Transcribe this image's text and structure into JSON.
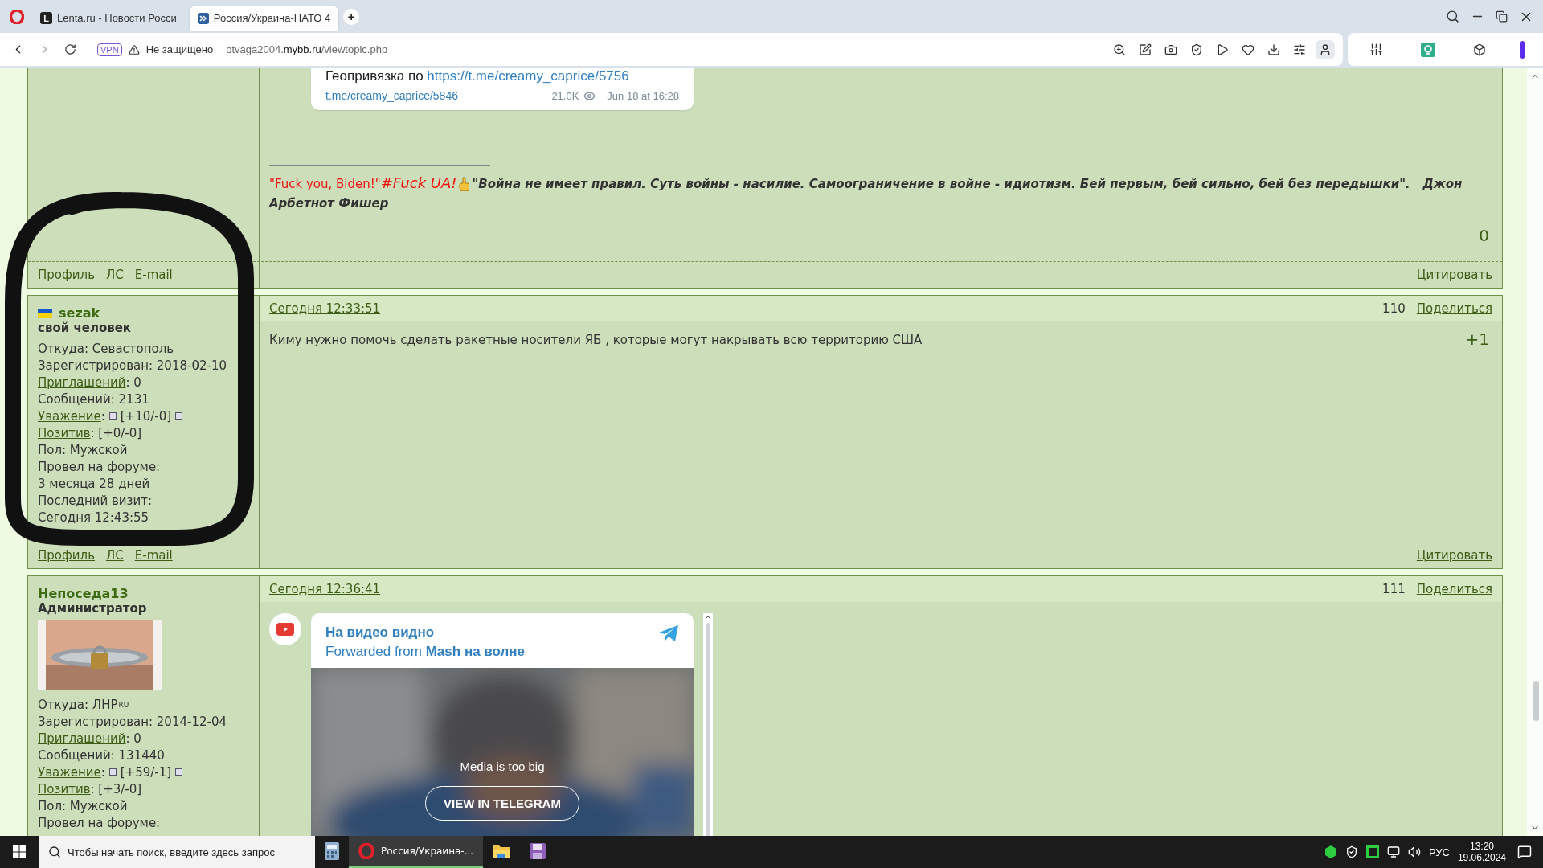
{
  "browser": {
    "tabs": [
      {
        "title": "Lenta.ru - Новости Росси",
        "selected": false,
        "favicon_letter": "L"
      },
      {
        "title": "Россия/Украина-НАТО 4",
        "selected": true
      }
    ],
    "new_tab": "+",
    "address": {
      "vpn": "VPN",
      "security": "Не защищено",
      "url_sub": "otvaga2004.",
      "url_domain": "mybb.ru",
      "url_path": "/viewtopic.php"
    }
  },
  "posts": [
    {
      "cut_top": true,
      "embed": {
        "kind": "geo",
        "text": "Геопривязка по ",
        "link": "https://t.me/creamy_caprice/5756",
        "footer_link": "t.me/creamy_caprice/5846",
        "views": "21.0K",
        "date": "Jun 18 at 16:28"
      },
      "signature": {
        "quote_red": "\"Fuck you, Biden!\"",
        "hashtag": "#Fuck UA!",
        "quote": "\"Война не имеет правил. Суть войны - насилие. Самоограничение в войне - идиотизм. Бей первым, бей сильно, бей без передышки\".   Джон",
        "quote_end": "Арбетнот Фишер"
      },
      "rating": "0",
      "footer": {
        "links": [
          "Профиль",
          "ЛС",
          "E-mail"
        ],
        "quote": "Цитировать"
      }
    },
    {
      "author": {
        "name": "sezak",
        "avatar": {
          "kind": "flag"
        },
        "title": "свой человек",
        "lines": [
          {
            "kind": "text",
            "text": "Откуда: Севастополь"
          },
          {
            "kind": "text",
            "text": "Зарегистрирован: 2018-02-10"
          },
          {
            "kind": "field",
            "label": "Приглашений",
            "value": ": 0"
          },
          {
            "kind": "text",
            "text": "Сообщений: 2131"
          },
          {
            "kind": "vote",
            "label": "Уважение",
            "sep": ":",
            "value": "[+10/-0]"
          },
          {
            "kind": "field",
            "label": "Позитив",
            "value": ": [+0/-0]"
          },
          {
            "kind": "text",
            "text": "Пол: Мужской"
          },
          {
            "kind": "text",
            "text": "Провел на форуме:"
          },
          {
            "kind": "text",
            "text": "3 месяца 28 дней"
          },
          {
            "kind": "text",
            "text": "Последний визит:"
          },
          {
            "kind": "text",
            "text": "Сегодня 12:43:55"
          }
        ]
      },
      "header": {
        "time": "Сегодня 12:33:51",
        "number": "110",
        "share": "Поделиться"
      },
      "text": "Киму нужно помочь сделать ракетные носители ЯБ , которые могут накрывать всю территорию США",
      "rating": "+1",
      "footer": {
        "links": [
          "Профиль",
          "ЛС",
          "E-mail"
        ],
        "quote": "Цитировать"
      }
    },
    {
      "author": {
        "name": "Непоседа13",
        "title": "Администратор",
        "lines": [
          {
            "kind": "text",
            "text": "Откуда: ЛНР",
            "suffix": "RU"
          },
          {
            "kind": "text",
            "text": "Зарегистрирован: 2014-12-04"
          },
          {
            "kind": "field",
            "label": "Приглашений",
            "value": ": 0"
          },
          {
            "kind": "text",
            "text": "Сообщений: 131440"
          },
          {
            "kind": "vote",
            "label": "Уважение",
            "sep": ":",
            "value": "[+59/-1]"
          },
          {
            "kind": "field",
            "label": "Позитив",
            "value": ": [+3/-0]"
          },
          {
            "kind": "text",
            "text": "Пол: Мужской"
          },
          {
            "kind": "text",
            "text": "Провел на форуме:"
          }
        ]
      },
      "header": {
        "time": "Сегодня 12:36:41",
        "number": "111",
        "share": "Поделиться"
      },
      "embed": {
        "kind": "video",
        "title": "На видео видно",
        "forwarded": "Forwarded from ",
        "source": "Mash на волне",
        "media_note": "Media is too big",
        "button": "VIEW IN TELEGRAM"
      }
    }
  ],
  "taskbar": {
    "placeholder": "Чтобы начать поиск, введите здесь запрос",
    "apps": [
      {
        "kind": "calculator",
        "selected": false
      },
      {
        "kind": "browser",
        "label": "Россия/Украина-...",
        "selected": true
      },
      {
        "kind": "folder",
        "selected": false
      },
      {
        "kind": "floppy",
        "selected": false
      }
    ],
    "language": "РУС",
    "time": "13:20",
    "date": "19.06.2024"
  }
}
